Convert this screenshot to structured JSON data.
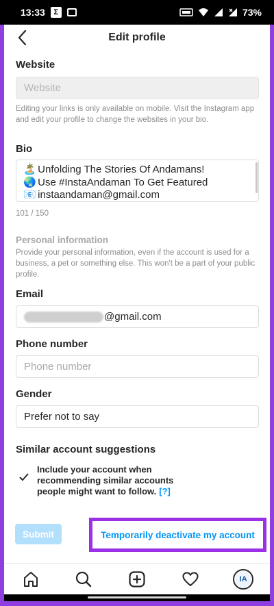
{
  "status_bar": {
    "time": "13:33",
    "battery": "73%"
  },
  "header": {
    "title": "Edit profile"
  },
  "website": {
    "label": "Website",
    "placeholder": "Website",
    "help": "Editing your links is only available on mobile. Visit the Instagram app and edit your profile to change the websites in your bio."
  },
  "bio": {
    "label": "Bio",
    "lines": [
      {
        "emoji": "🏝️",
        "text": "Unfolding The Stories Of Andamans!"
      },
      {
        "emoji": "🌏",
        "text": "Use #InstaAndaman To Get Featured"
      },
      {
        "emoji": "📧",
        "text": "instaandaman@gmail.com"
      }
    ],
    "counter": "101 / 150"
  },
  "personal": {
    "title": "Personal information",
    "help": "Provide your personal information, even if the account is used for a business, a pet or something else. This won't be a part of your public profile."
  },
  "email": {
    "label": "Email",
    "value_suffix": "@gmail.com"
  },
  "phone": {
    "label": "Phone number",
    "placeholder": "Phone number"
  },
  "gender": {
    "label": "Gender",
    "value": "Prefer not to say"
  },
  "similar": {
    "label": "Similar account suggestions",
    "checkbox_text": "Include your account when recommending similar accounts people might want to follow.",
    "help_link": "[?]",
    "checked": true
  },
  "actions": {
    "submit": "Submit",
    "deactivate": "Temporarily deactivate my account"
  },
  "bottom_nav": {
    "items": [
      "home-icon",
      "search-icon",
      "new-post-icon",
      "heart-icon",
      "profile-avatar"
    ],
    "avatar_text": "IA"
  },
  "colors": {
    "link": "#0095f6",
    "highlight": "#9b30e6",
    "submit_disabled": "#b2dffc"
  }
}
